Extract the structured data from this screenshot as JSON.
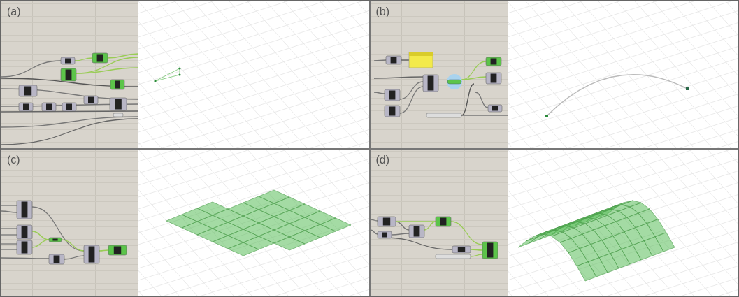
{
  "panels": [
    {
      "label": "(a)",
      "kind": "polyline"
    },
    {
      "label": "(b)",
      "kind": "arc"
    },
    {
      "label": "(c)",
      "kind": "flat-tiles"
    },
    {
      "label": "(d)",
      "kind": "arched-tiles"
    }
  ]
}
